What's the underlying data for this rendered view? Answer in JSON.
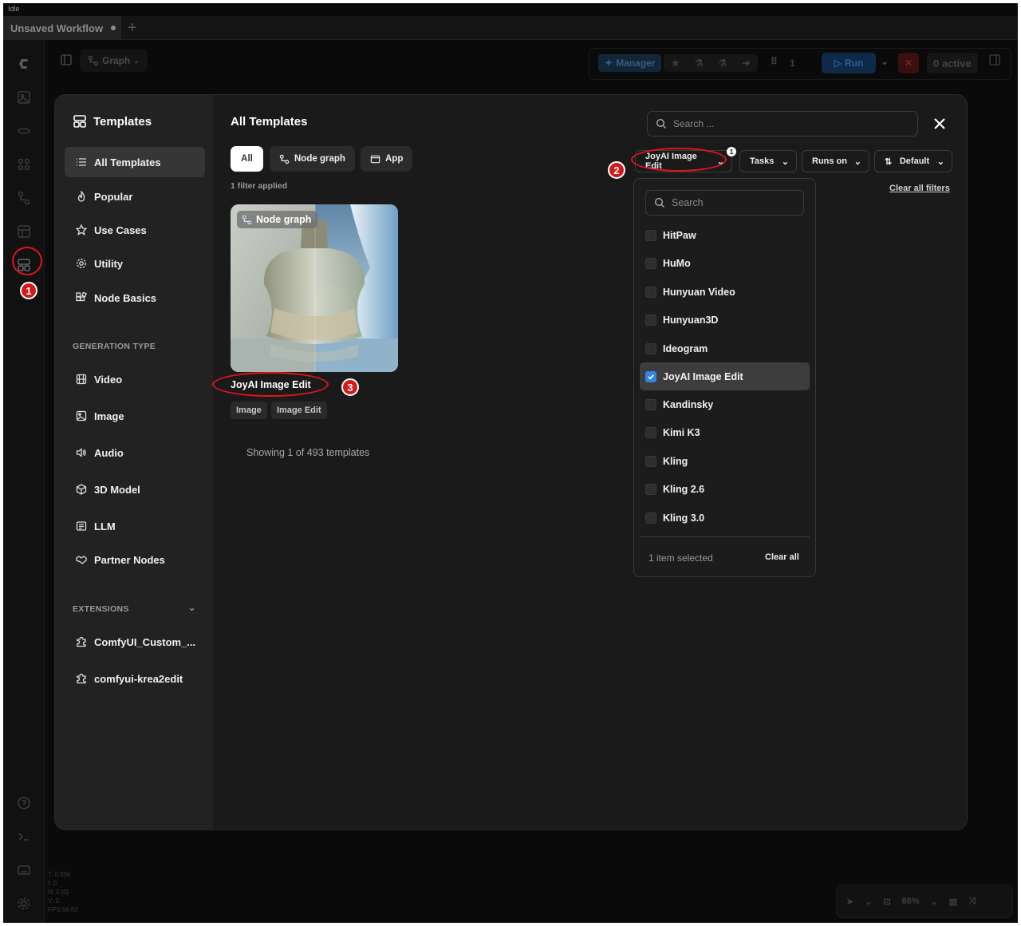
{
  "window": {
    "status": "Idle",
    "tab_title": "Unsaved Workflow"
  },
  "toolbar": {
    "graph_label": "Graph",
    "manager_label": "Manager",
    "queue_count": "1",
    "run_label": "Run",
    "active_label": "0 active",
    "zoom_label": "86%"
  },
  "canvas_stats": [
    "T: 0.00s",
    "I: 0",
    "N: 0 [0]",
    "V: 0",
    "FPS:58.82"
  ],
  "sidebar": {
    "title": "Templates",
    "items": [
      {
        "label": "All Templates",
        "icon": "list-icon"
      },
      {
        "label": "Popular",
        "icon": "flame-icon"
      },
      {
        "label": "Use Cases",
        "icon": "star-icon"
      },
      {
        "label": "Utility",
        "icon": "gear-icon"
      },
      {
        "label": "Node Basics",
        "icon": "blocks-icon"
      }
    ],
    "generation_type_label": "GENERATION TYPE",
    "generation_types": [
      {
        "label": "Video",
        "icon": "film-icon"
      },
      {
        "label": "Image",
        "icon": "image-icon"
      },
      {
        "label": "Audio",
        "icon": "audio-icon"
      },
      {
        "label": "3D Model",
        "icon": "cube-icon"
      },
      {
        "label": "LLM",
        "icon": "text-icon"
      },
      {
        "label": "Partner Nodes",
        "icon": "handshake-icon"
      }
    ],
    "extensions_label": "EXTENSIONS",
    "extensions": [
      {
        "label": "ComfyUI_Custom_...",
        "icon": "puzzle-icon"
      },
      {
        "label": "comfyui-krea2edit",
        "icon": "puzzle-icon"
      }
    ]
  },
  "main": {
    "title": "All Templates",
    "type_tabs": [
      {
        "label": "All"
      },
      {
        "label": "Node graph",
        "icon": "graph-icon"
      },
      {
        "label": "App",
        "icon": "app-icon"
      }
    ],
    "filter_count": "1 filter applied",
    "card": {
      "badge": "Node graph",
      "title": "JoyAI Image Edit",
      "tags": [
        "Image",
        "Image Edit"
      ]
    },
    "showing": "Showing 1 of 493 templates"
  },
  "filters": {
    "search_placeholder": "Search ...",
    "model_filter_label": "JoyAI Image Edit",
    "model_filter_count": "1",
    "tasks_label": "Tasks",
    "runs_on_label": "Runs on",
    "sort_label": "Default",
    "clear_all_filters": "Clear all filters"
  },
  "dropdown": {
    "search_placeholder": "Search",
    "options": [
      {
        "label": "HitPaw",
        "checked": false
      },
      {
        "label": "HuMo",
        "checked": false
      },
      {
        "label": "Hunyuan Video",
        "checked": false
      },
      {
        "label": "Hunyuan3D",
        "checked": false
      },
      {
        "label": "Ideogram",
        "checked": false
      },
      {
        "label": "JoyAI Image Edit",
        "checked": true
      },
      {
        "label": "Kandinsky",
        "checked": false
      },
      {
        "label": "Kimi K3",
        "checked": false
      },
      {
        "label": "Kling",
        "checked": false
      },
      {
        "label": "Kling 2.6",
        "checked": false
      },
      {
        "label": "Kling 3.0",
        "checked": false
      }
    ],
    "selected_count": "1 item selected",
    "clear_label": "Clear all"
  },
  "callouts": [
    "1",
    "2",
    "3"
  ],
  "colors": {
    "accent_blue": "#2f86e6",
    "callout_red": "#d11a1a",
    "modal_bg": "#1a1a1a"
  }
}
